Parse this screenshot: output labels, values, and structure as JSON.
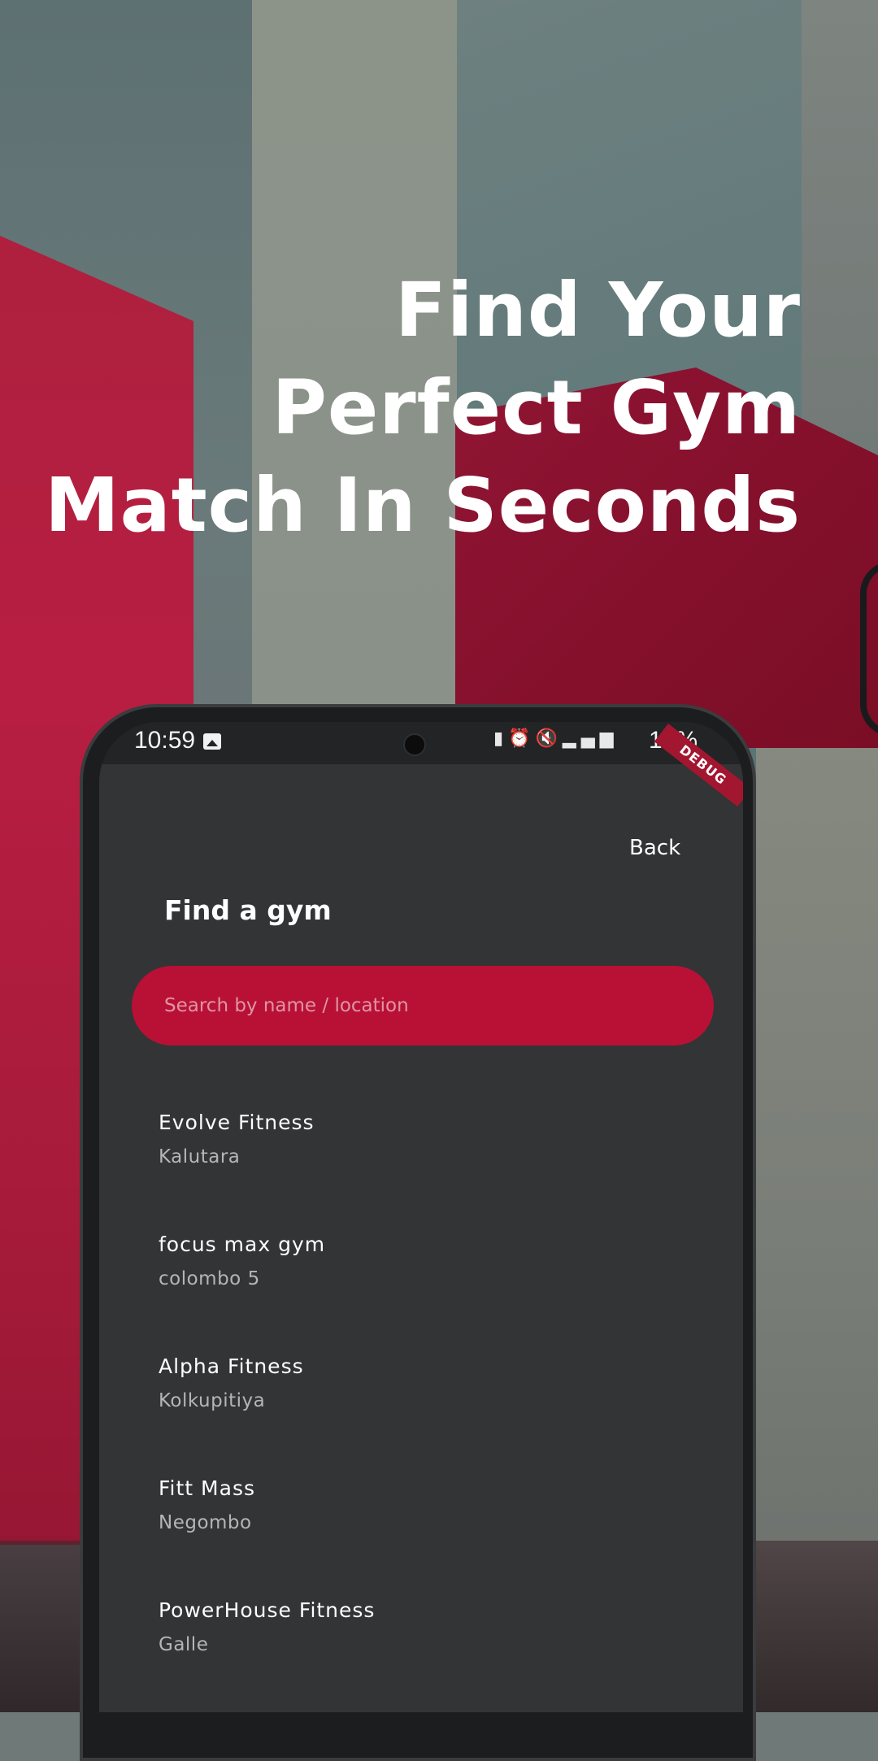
{
  "headline": {
    "line1": "Find Your",
    "line2": "Perfect Gym",
    "line3": "Match In Seconds"
  },
  "status_bar": {
    "time": "10:59",
    "battery": "16%",
    "debug_label": "DEBUG",
    "icons": [
      "gallery-icon",
      "battery-saver-icon",
      "alarm-icon",
      "mute-icon",
      "volte-icon",
      "4g-icon",
      "signal-icon"
    ]
  },
  "header": {
    "back_label": "Back",
    "title": "Find a gym"
  },
  "search": {
    "placeholder": "Search by name / location"
  },
  "gyms": [
    {
      "name": "Evolve Fitness",
      "location": "Kalutara"
    },
    {
      "name": "focus max gym",
      "location": "colombo 5"
    },
    {
      "name": "Alpha Fitness",
      "location": "Kolkupitiya"
    },
    {
      "name": "Fitt Mass",
      "location": "Negombo"
    },
    {
      "name": "PowerHouse Fitness",
      "location": "Galle"
    }
  ],
  "colors": {
    "accent": "#b81135",
    "screen_bg": "#333436",
    "text_primary": "#ffffff",
    "text_secondary": "#b5b5b7"
  }
}
